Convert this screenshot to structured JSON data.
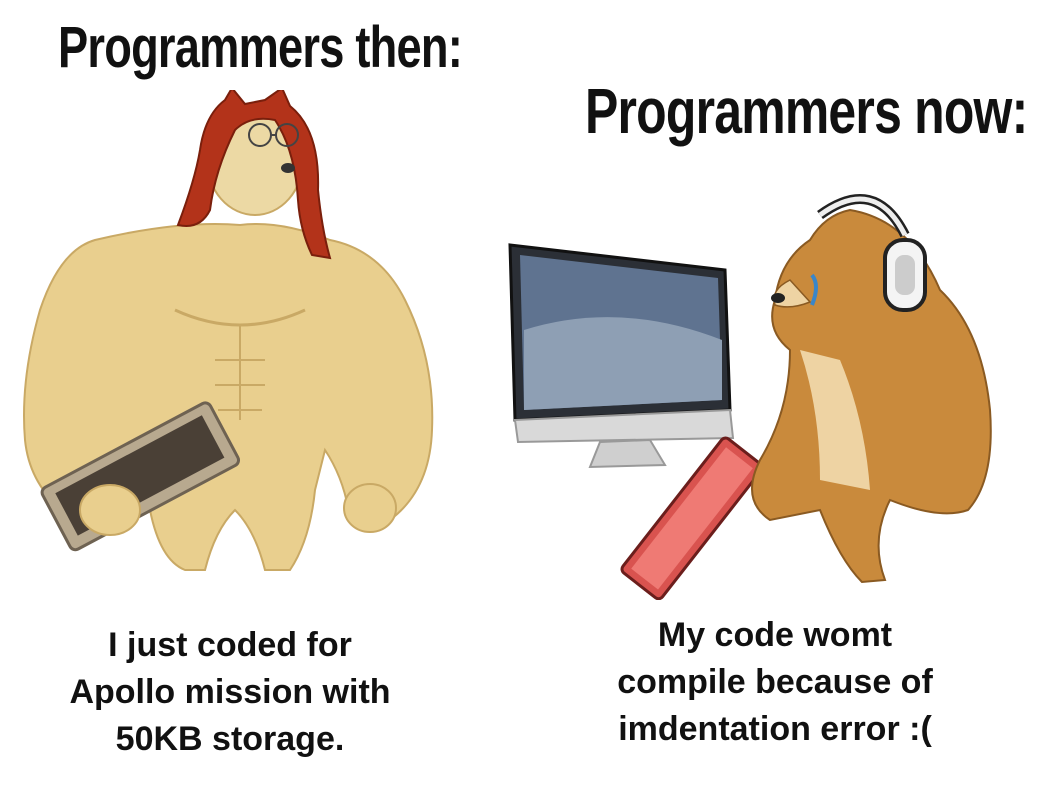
{
  "left": {
    "title": "Programmers then:",
    "caption_lines": [
      "I just coded for",
      "Apollo mission with",
      "50KB storage."
    ]
  },
  "right": {
    "title": "Programmers now:",
    "caption_lines": [
      "My code womt",
      "compile because of",
      "imdentation error :("
    ]
  },
  "colors": {
    "buff_doge_fur": "#e9cf8e",
    "wig_red": "#b3331a",
    "cheems_fur": "#c98a3c",
    "keyboard_red": "#d9534f"
  }
}
